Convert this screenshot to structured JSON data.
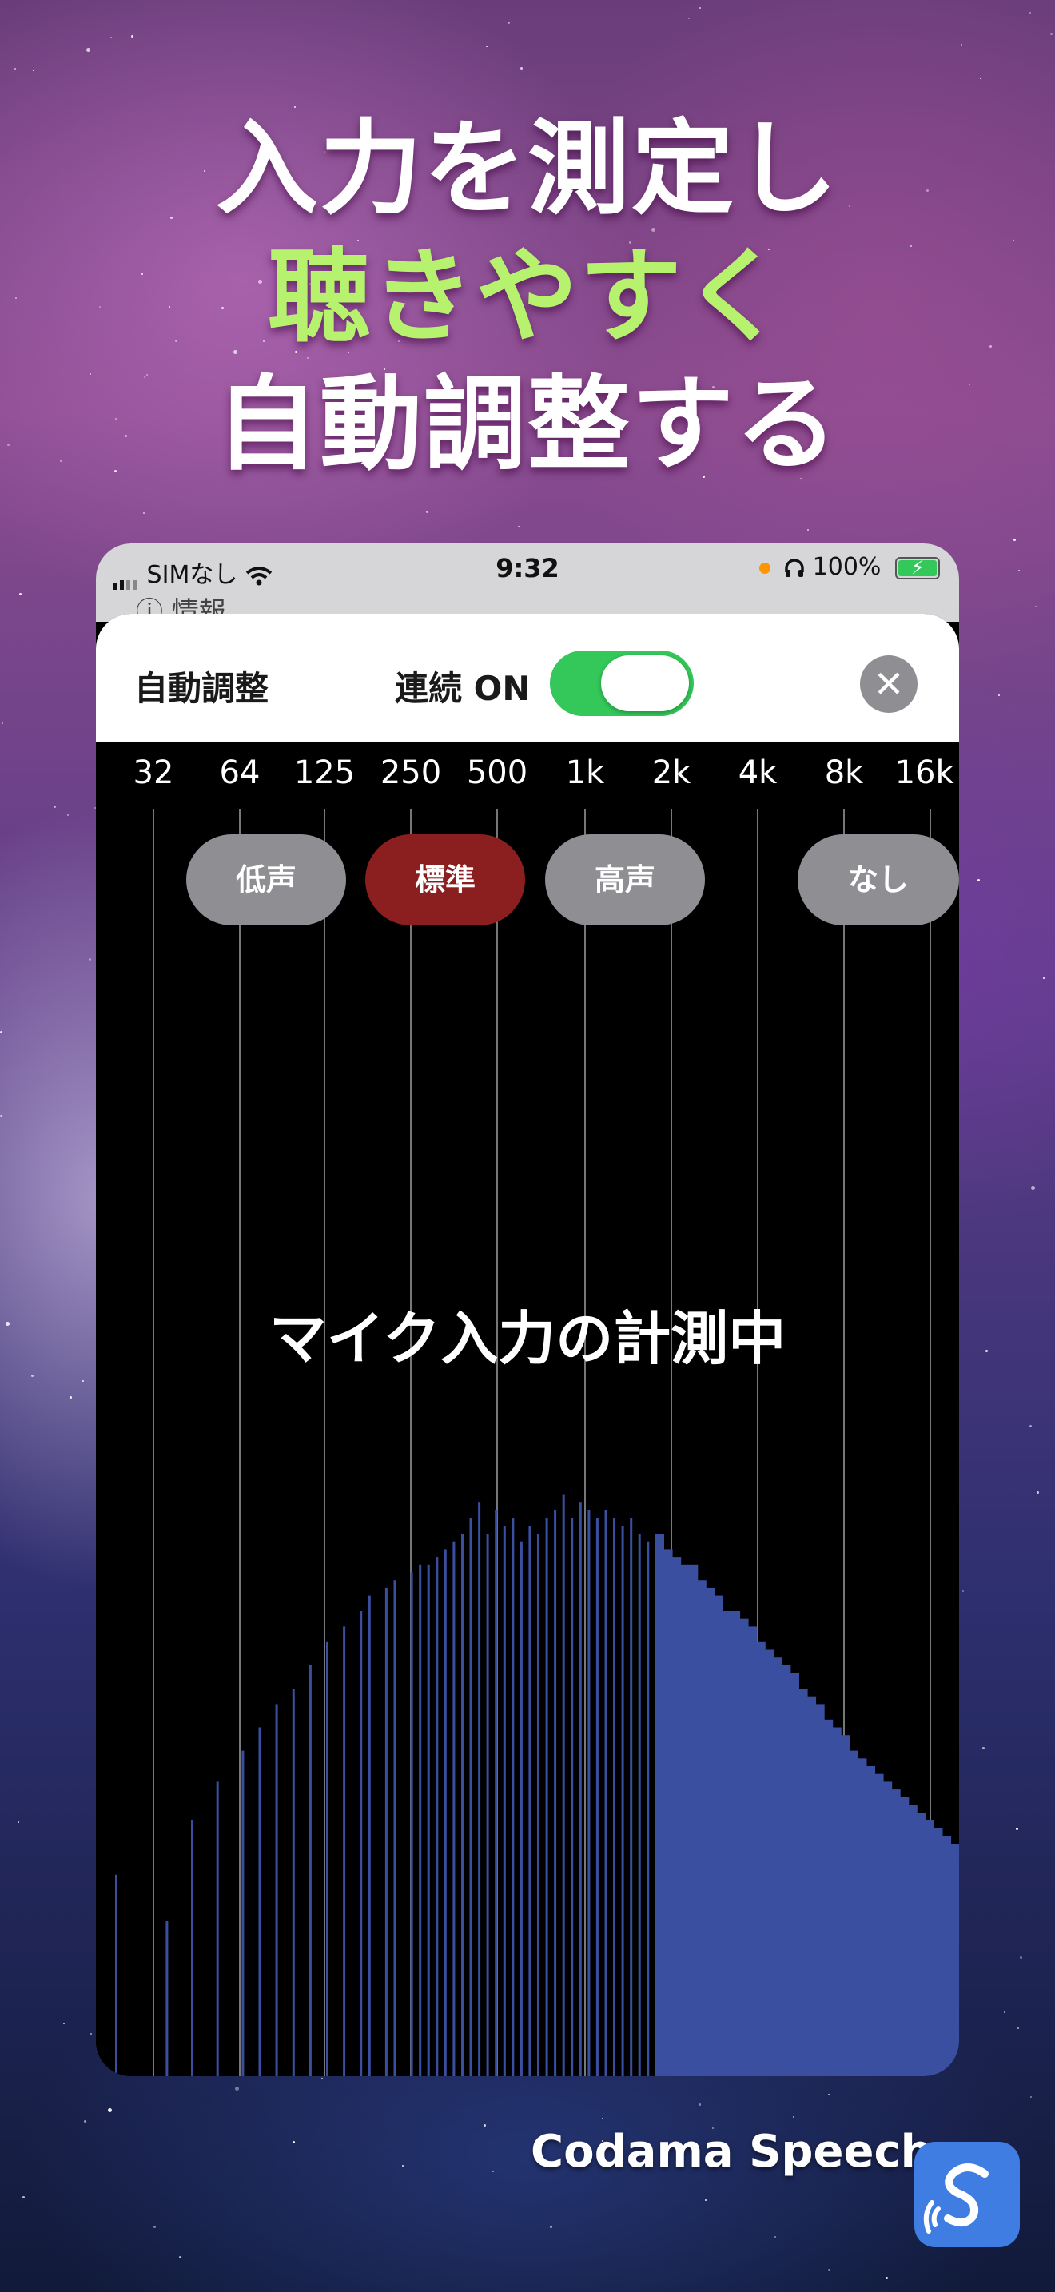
{
  "headline": {
    "line1": "入力を測定し",
    "line2": "聴きやすく",
    "line3": "自動調整する",
    "accent_color": "#b6f26e"
  },
  "status_bar": {
    "carrier": "SIMなし",
    "time": "9:32",
    "battery": "100%"
  },
  "behind_header": {
    "info_label": "情報"
  },
  "sheet": {
    "title": "自動調整",
    "continuous_label": "連続 ON",
    "toggle_on": true,
    "close_icon": "close-icon"
  },
  "frequency_axis": {
    "labels": [
      "32",
      "64",
      "125",
      "250",
      "500",
      "1k",
      "2k",
      "4k",
      "8k",
      "16k"
    ]
  },
  "presets": {
    "items": [
      {
        "label": "低声",
        "active": false
      },
      {
        "label": "標準",
        "active": true
      },
      {
        "label": "高声",
        "active": false
      },
      {
        "label": "なし",
        "active": false
      }
    ]
  },
  "status_message": "マイク入力の計測中",
  "spectrum": {
    "bar_color": "#3a4fa0",
    "levels": [
      0.26,
      0.0,
      0.0,
      0.0,
      0.0,
      0.0,
      0.2,
      0.0,
      0.0,
      0.33,
      0.0,
      0.0,
      0.38,
      0.0,
      0.0,
      0.42,
      0.0,
      0.45,
      0.0,
      0.48,
      0.0,
      0.5,
      0.0,
      0.53,
      0.0,
      0.56,
      0.0,
      0.58,
      0.0,
      0.6,
      0.62,
      0.0,
      0.63,
      0.64,
      0.0,
      0.65,
      0.66,
      0.66,
      0.67,
      0.68,
      0.69,
      0.7,
      0.72,
      0.74,
      0.7,
      0.73,
      0.71,
      0.72,
      0.69,
      0.71,
      0.7,
      0.72,
      0.73,
      0.75,
      0.72,
      0.74,
      0.73,
      0.72,
      0.73,
      0.72,
      0.71,
      0.72,
      0.7,
      0.69,
      0.7,
      0.68,
      0.67,
      0.66,
      0.66,
      0.64,
      0.63,
      0.62,
      0.6,
      0.6,
      0.59,
      0.58,
      0.56,
      0.55,
      0.54,
      0.53,
      0.52,
      0.5,
      0.49,
      0.48,
      0.46,
      0.45,
      0.44,
      0.42,
      0.41,
      0.4,
      0.39,
      0.38,
      0.37,
      0.36,
      0.35,
      0.34,
      0.33,
      0.32,
      0.31,
      0.3
    ]
  },
  "brand": {
    "name": "Codama Speech"
  }
}
